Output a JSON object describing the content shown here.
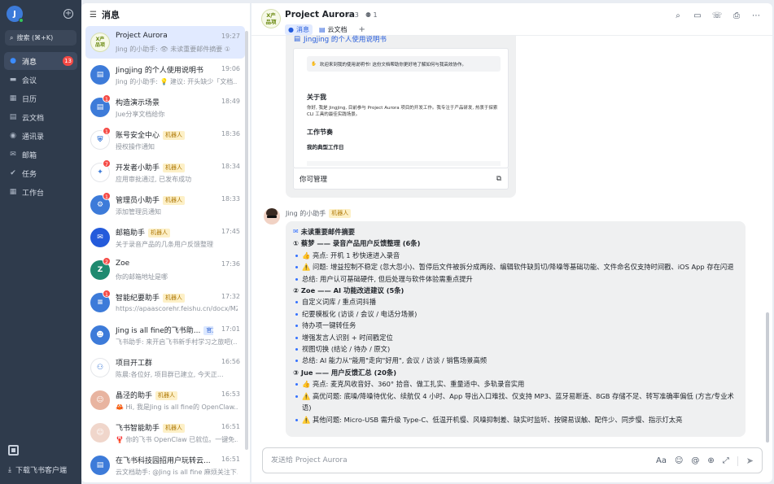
{
  "nav": {
    "avatar_letter": "J",
    "search_placeholder": "搜索 (⌘+K)",
    "items": [
      {
        "label": "消息",
        "icon": "chat-bubble-icon",
        "badge": "13",
        "active": true
      },
      {
        "label": "会议",
        "icon": "video-icon"
      },
      {
        "label": "日历",
        "icon": "calendar-icon"
      },
      {
        "label": "云文档",
        "icon": "cloud-doc-icon"
      },
      {
        "label": "通讯录",
        "icon": "contacts-icon"
      },
      {
        "label": "邮箱",
        "icon": "mail-icon"
      },
      {
        "label": "任务",
        "icon": "task-check-icon"
      },
      {
        "label": "工作台",
        "icon": "grid-apps-icon"
      }
    ],
    "download_label": "下载飞书客户端"
  },
  "list": {
    "title": "消息",
    "conversations": [
      {
        "name": "Project Aurora",
        "time": "19:27",
        "preview": "Jing 的小助手: 👁 未读重要邮件摘要 ①",
        "avatar_text": "X产\n品项",
        "avatar_color": "#f6f9e8",
        "active": true
      },
      {
        "name": "Jingjing 的个人使用说明书",
        "time": "19:06",
        "preview": "Jing 的小助手: 💡 建议: 开头缺少「文档...",
        "avatar_color": "#3d7bd9",
        "avatar_icon": "doc-icon"
      },
      {
        "name": "构造演示场景",
        "time": "18:49",
        "preview": "Jue分享文档给你",
        "avatar_color": "#3d7bd9",
        "avatar_icon": "doc-icon",
        "badge": "1"
      },
      {
        "name": "账号安全中心",
        "tag": "机器人",
        "time": "18:36",
        "preview": "授权操作通知",
        "avatar_color": "#ffffff",
        "avatar_icon": "shield-icon",
        "badge": "1"
      },
      {
        "name": "开发者小助手",
        "tag": "机器人",
        "time": "18:34",
        "preview": "应用审批通过, 已发布成功",
        "avatar_color": "#ffffff",
        "avatar_icon": "dev-assistant-icon",
        "badge": "7"
      },
      {
        "name": "管理员小助手",
        "tag": "机器人",
        "time": "18:33",
        "preview": "添加管理员通知",
        "avatar_color": "#3d7bd9",
        "avatar_icon": "admin-icon",
        "badge": "1"
      },
      {
        "name": "邮箱助手",
        "tag": "机器人",
        "time": "17:45",
        "preview": "关于录音产品的几条用户反馈整理",
        "avatar_color": "#245bdb",
        "avatar_icon": "mail-icon"
      },
      {
        "name": "Zoe",
        "time": "17:36",
        "preview": "你的邮箱地址是哪",
        "avatar_color": "#1f8a70",
        "avatar_letter": "Z",
        "badge": "2"
      },
      {
        "name": "智能纪要助手",
        "tag": "机器人",
        "time": "17:32",
        "preview": "https://apaascorehr.feishu.cn/docx/MZ...",
        "avatar_color": "#3d7bd9",
        "avatar_icon": "notes-icon",
        "badge": "1"
      },
      {
        "name": "Jing is all fine的飞书助...",
        "tag": "官方",
        "tag_style": "blue",
        "time": "17:01",
        "preview": "飞书助手: 来开启飞书新手村学习之旅吧(...",
        "avatar_color": "#3d7bd9",
        "avatar_icon": "robot-icon"
      },
      {
        "name": "项目开工群",
        "time": "16:56",
        "preview": "陈晨:各位好, 项目群已建立, 今天正...",
        "avatar_color": "#ffffff",
        "avatar_icon": "group-icon"
      },
      {
        "name": "晶泾的助手",
        "tag": "机器人",
        "time": "16:53",
        "preview": "🦀 Hi, 我是Jing is all fine的 OpenClaw...",
        "avatar_color": "#e8b4a0",
        "avatar_icon": "photo-avatar-icon"
      },
      {
        "name": "飞书智能助手",
        "tag": "机器人",
        "time": "16:51",
        "preview": "🦞 你的飞书 OpenClaw 已就位。一键免...",
        "avatar_color": "#f0d6cb",
        "avatar_icon": "photo-avatar-icon"
      },
      {
        "name": "在飞书科技园招用户玩转云...",
        "time": "16:51",
        "preview": "云文档助手: @Jing is all fine 麻烦关注下...",
        "avatar_color": "#3d7bd9",
        "avatar_icon": "doc-icon"
      }
    ]
  },
  "chat": {
    "group_avatar": "X产\n品项",
    "title": "Project Aurora",
    "member_count": "3",
    "bot_count": "1",
    "tabs": [
      {
        "label": "消息",
        "icon": "chat-bubble-icon",
        "active": true
      },
      {
        "label": "云文档",
        "icon": "cloud-doc-icon"
      }
    ],
    "top_icons": [
      "search-person-icon",
      "video-call-icon",
      "phone-icon",
      "inbox-icon",
      "more-icon"
    ],
    "doc_card": {
      "link_text": "Jingjing 的个人使用说明书",
      "callout": "欢迎来到我的使用说明书! 这份文档帮助你更好地了解如何与我高效协作。",
      "about_heading": "关于我",
      "about_text": "你好, 我是 Jingjing, 目前参与 Project Aurora 项目的开发工作。我专注于产品研发, 热衷于探索 CLI 工具的最佳实践场景。",
      "rhythm_heading": "工作节奏",
      "typical_day": "我的典型工作日",
      "permission": "你可管理"
    },
    "message": {
      "sender": "Jing 的小助手",
      "sender_tag": "机器人",
      "title": "未读重要邮件摘要",
      "lines": [
        {
          "kind": "section",
          "text": "① 蔡梦 —— 录音产品用户反馈整理 (6条)"
        },
        {
          "kind": "bullet",
          "text": "👍 亮点: 开机 1 秒快速进入录音"
        },
        {
          "kind": "bullet",
          "text": "⚠️ 问题: 增益控制不稳定 (忽大忽小)、暂停后文件被拆分成两段、编辑软件缺剪切/降噪等基础功能、文件命名仅支持时间戳、iOS App 存在闪退",
          "wrap": true
        },
        {
          "kind": "bullet",
          "text": "总结: 用户认可基础硬件, 但后处理与软件体验需重点提升"
        },
        {
          "kind": "section",
          "text": "② Zoe —— AI 功能改进建议 (5条)"
        },
        {
          "kind": "bullet",
          "text": "自定义词库 / 重点词抖播"
        },
        {
          "kind": "bullet",
          "text": "纪要模板化 (访谈 / 会议 / 电话分场景)"
        },
        {
          "kind": "bullet",
          "text": "待办项一键转任务"
        },
        {
          "kind": "bullet",
          "text": "增强发言人识别 + 时间戳定位"
        },
        {
          "kind": "bullet",
          "text": "视图切换 (结论 / 待办 / 原文)"
        },
        {
          "kind": "bullet",
          "text": "总结: AI 能力从\"能用\"走向\"好用\", 会议 / 访谈 / 销售场景高频"
        },
        {
          "kind": "section",
          "text": "③ Jue —— 用户反馈汇总 (20条)"
        },
        {
          "kind": "bullet",
          "text": "👍 亮点: 麦克风收音好、360° 拾音、做工扎实、重量适中、多轨录音实用"
        },
        {
          "kind": "bullet",
          "text": "⚠️ 高优问题: 底噪/降噪待优化、续航仅 4 小时、App 导出入口难找、仅支持 MP3、蓝牙易断连、8GB 存储不足、转写准确率偏低 (方言/专业术语)",
          "wrap": true
        },
        {
          "kind": "bullet",
          "text": "⚠️ 其他问题: Micro-USB 需升级 Type-C、低温开机慢、风噪抑制差、缺实时监听、按键易误触、配件少、同步慢、指示灯太亮"
        }
      ]
    },
    "composer": {
      "placeholder": "发送给 Project Aurora",
      "tools": [
        "text-format-icon",
        "emoji-icon",
        "mention-icon",
        "plus-circle-icon",
        "expand-icon",
        "send-icon"
      ]
    }
  }
}
